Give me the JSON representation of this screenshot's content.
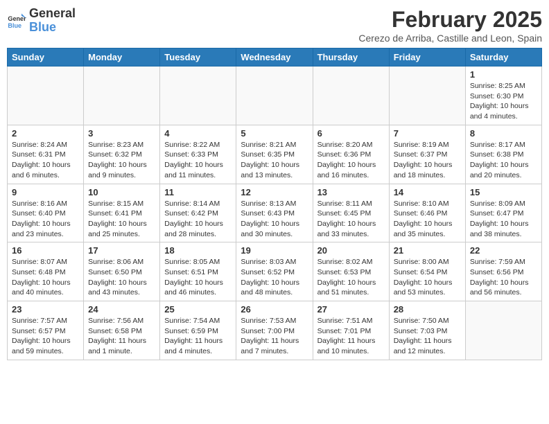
{
  "header": {
    "logo_line1": "General",
    "logo_line2": "Blue",
    "month": "February 2025",
    "location": "Cerezo de Arriba, Castille and Leon, Spain"
  },
  "days_of_week": [
    "Sunday",
    "Monday",
    "Tuesday",
    "Wednesday",
    "Thursday",
    "Friday",
    "Saturday"
  ],
  "weeks": [
    [
      {
        "day": "",
        "info": ""
      },
      {
        "day": "",
        "info": ""
      },
      {
        "day": "",
        "info": ""
      },
      {
        "day": "",
        "info": ""
      },
      {
        "day": "",
        "info": ""
      },
      {
        "day": "",
        "info": ""
      },
      {
        "day": "1",
        "info": "Sunrise: 8:25 AM\nSunset: 6:30 PM\nDaylight: 10 hours\nand 4 minutes."
      }
    ],
    [
      {
        "day": "2",
        "info": "Sunrise: 8:24 AM\nSunset: 6:31 PM\nDaylight: 10 hours\nand 6 minutes."
      },
      {
        "day": "3",
        "info": "Sunrise: 8:23 AM\nSunset: 6:32 PM\nDaylight: 10 hours\nand 9 minutes."
      },
      {
        "day": "4",
        "info": "Sunrise: 8:22 AM\nSunset: 6:33 PM\nDaylight: 10 hours\nand 11 minutes."
      },
      {
        "day": "5",
        "info": "Sunrise: 8:21 AM\nSunset: 6:35 PM\nDaylight: 10 hours\nand 13 minutes."
      },
      {
        "day": "6",
        "info": "Sunrise: 8:20 AM\nSunset: 6:36 PM\nDaylight: 10 hours\nand 16 minutes."
      },
      {
        "day": "7",
        "info": "Sunrise: 8:19 AM\nSunset: 6:37 PM\nDaylight: 10 hours\nand 18 minutes."
      },
      {
        "day": "8",
        "info": "Sunrise: 8:17 AM\nSunset: 6:38 PM\nDaylight: 10 hours\nand 20 minutes."
      }
    ],
    [
      {
        "day": "9",
        "info": "Sunrise: 8:16 AM\nSunset: 6:40 PM\nDaylight: 10 hours\nand 23 minutes."
      },
      {
        "day": "10",
        "info": "Sunrise: 8:15 AM\nSunset: 6:41 PM\nDaylight: 10 hours\nand 25 minutes."
      },
      {
        "day": "11",
        "info": "Sunrise: 8:14 AM\nSunset: 6:42 PM\nDaylight: 10 hours\nand 28 minutes."
      },
      {
        "day": "12",
        "info": "Sunrise: 8:13 AM\nSunset: 6:43 PM\nDaylight: 10 hours\nand 30 minutes."
      },
      {
        "day": "13",
        "info": "Sunrise: 8:11 AM\nSunset: 6:45 PM\nDaylight: 10 hours\nand 33 minutes."
      },
      {
        "day": "14",
        "info": "Sunrise: 8:10 AM\nSunset: 6:46 PM\nDaylight: 10 hours\nand 35 minutes."
      },
      {
        "day": "15",
        "info": "Sunrise: 8:09 AM\nSunset: 6:47 PM\nDaylight: 10 hours\nand 38 minutes."
      }
    ],
    [
      {
        "day": "16",
        "info": "Sunrise: 8:07 AM\nSunset: 6:48 PM\nDaylight: 10 hours\nand 40 minutes."
      },
      {
        "day": "17",
        "info": "Sunrise: 8:06 AM\nSunset: 6:50 PM\nDaylight: 10 hours\nand 43 minutes."
      },
      {
        "day": "18",
        "info": "Sunrise: 8:05 AM\nSunset: 6:51 PM\nDaylight: 10 hours\nand 46 minutes."
      },
      {
        "day": "19",
        "info": "Sunrise: 8:03 AM\nSunset: 6:52 PM\nDaylight: 10 hours\nand 48 minutes."
      },
      {
        "day": "20",
        "info": "Sunrise: 8:02 AM\nSunset: 6:53 PM\nDaylight: 10 hours\nand 51 minutes."
      },
      {
        "day": "21",
        "info": "Sunrise: 8:00 AM\nSunset: 6:54 PM\nDaylight: 10 hours\nand 53 minutes."
      },
      {
        "day": "22",
        "info": "Sunrise: 7:59 AM\nSunset: 6:56 PM\nDaylight: 10 hours\nand 56 minutes."
      }
    ],
    [
      {
        "day": "23",
        "info": "Sunrise: 7:57 AM\nSunset: 6:57 PM\nDaylight: 10 hours\nand 59 minutes."
      },
      {
        "day": "24",
        "info": "Sunrise: 7:56 AM\nSunset: 6:58 PM\nDaylight: 11 hours\nand 1 minute."
      },
      {
        "day": "25",
        "info": "Sunrise: 7:54 AM\nSunset: 6:59 PM\nDaylight: 11 hours\nand 4 minutes."
      },
      {
        "day": "26",
        "info": "Sunrise: 7:53 AM\nSunset: 7:00 PM\nDaylight: 11 hours\nand 7 minutes."
      },
      {
        "day": "27",
        "info": "Sunrise: 7:51 AM\nSunset: 7:01 PM\nDaylight: 11 hours\nand 10 minutes."
      },
      {
        "day": "28",
        "info": "Sunrise: 7:50 AM\nSunset: 7:03 PM\nDaylight: 11 hours\nand 12 minutes."
      },
      {
        "day": "",
        "info": ""
      }
    ]
  ]
}
